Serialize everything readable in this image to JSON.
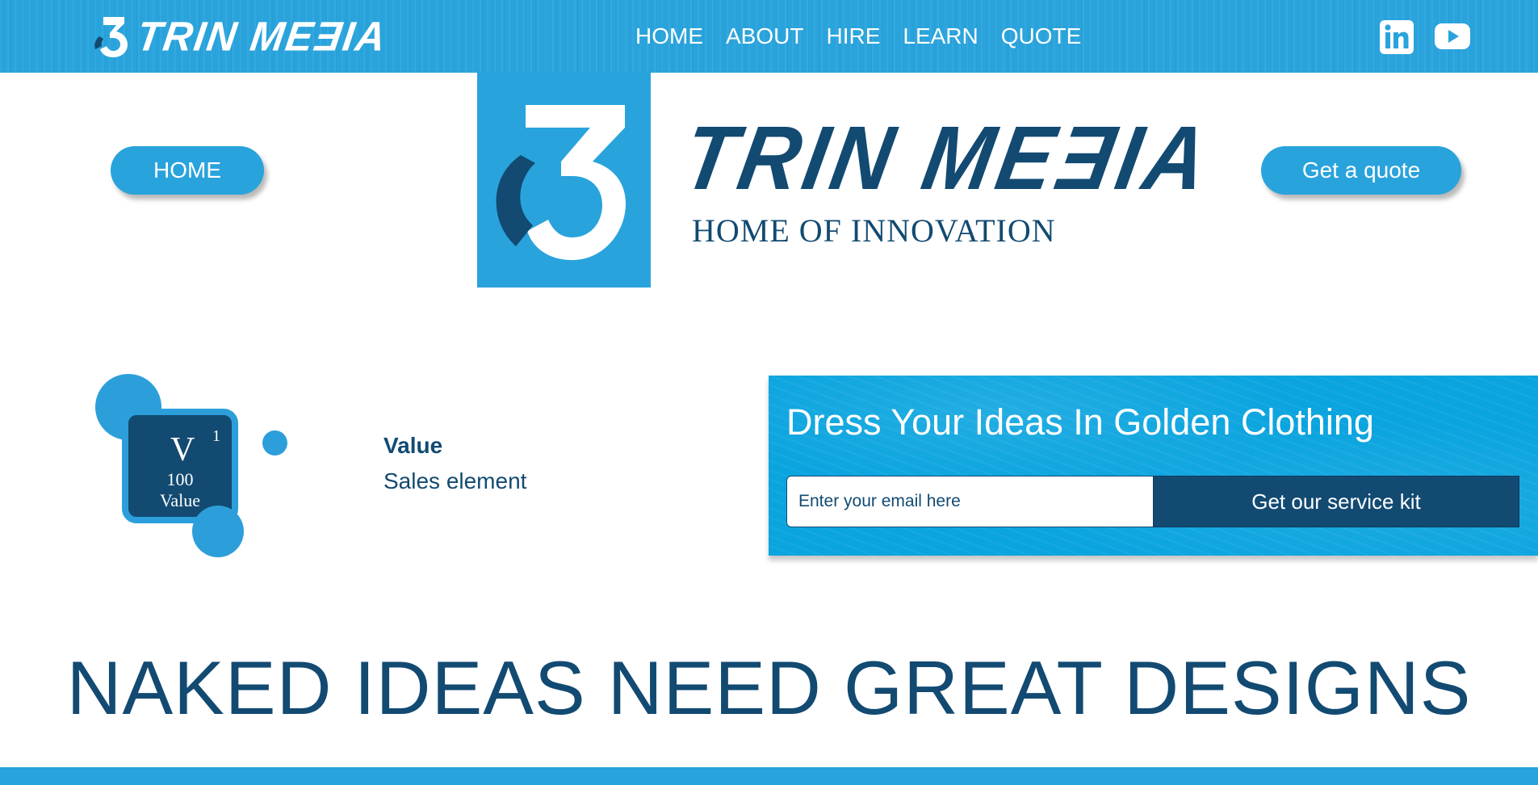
{
  "nav": {
    "brand": "TRIN MEƎIA",
    "links": [
      "HOME",
      "ABOUT",
      "HIRE",
      "LEARN",
      "QUOTE"
    ],
    "social": [
      "linkedin-icon",
      "youtube-icon"
    ]
  },
  "header": {
    "home_button": "HOME",
    "quote_button": "Get a quote",
    "brand": "TRIN MEƎIA",
    "tagline": "HOME OF INNOVATION"
  },
  "element": {
    "symbol": "V",
    "number": "1",
    "mass": "100",
    "name": "Value",
    "title": "Value",
    "subtitle": "Sales element"
  },
  "subscribe": {
    "title": "Dress Your Ideas In Golden Clothing",
    "email_placeholder": "Enter your email here",
    "button": "Get our service kit"
  },
  "headline": "NAKED IDEAS NEED GREAT DESIGNS",
  "colors": {
    "brand_blue": "#29a3dc",
    "navy": "#124a72",
    "white": "#ffffff"
  }
}
